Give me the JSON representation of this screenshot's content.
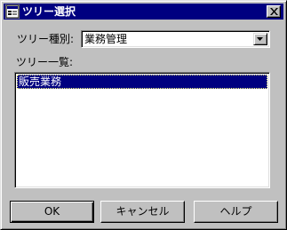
{
  "window": {
    "title": "ツリー選択"
  },
  "tree_type": {
    "label": "ツリー種別:",
    "selected": "業務管理"
  },
  "tree_list": {
    "label": "ツリー一覧:",
    "items": [
      "販売業務"
    ]
  },
  "buttons": {
    "ok": "OK",
    "cancel": "キャンセル",
    "help": "ヘルプ"
  },
  "icons": {
    "app": "app-window-icon",
    "close": "close-icon",
    "dropdown": "chevron-down-icon"
  },
  "colors": {
    "titlebar": "#000080",
    "selection": "#000080",
    "face": "#c0c0c0"
  }
}
